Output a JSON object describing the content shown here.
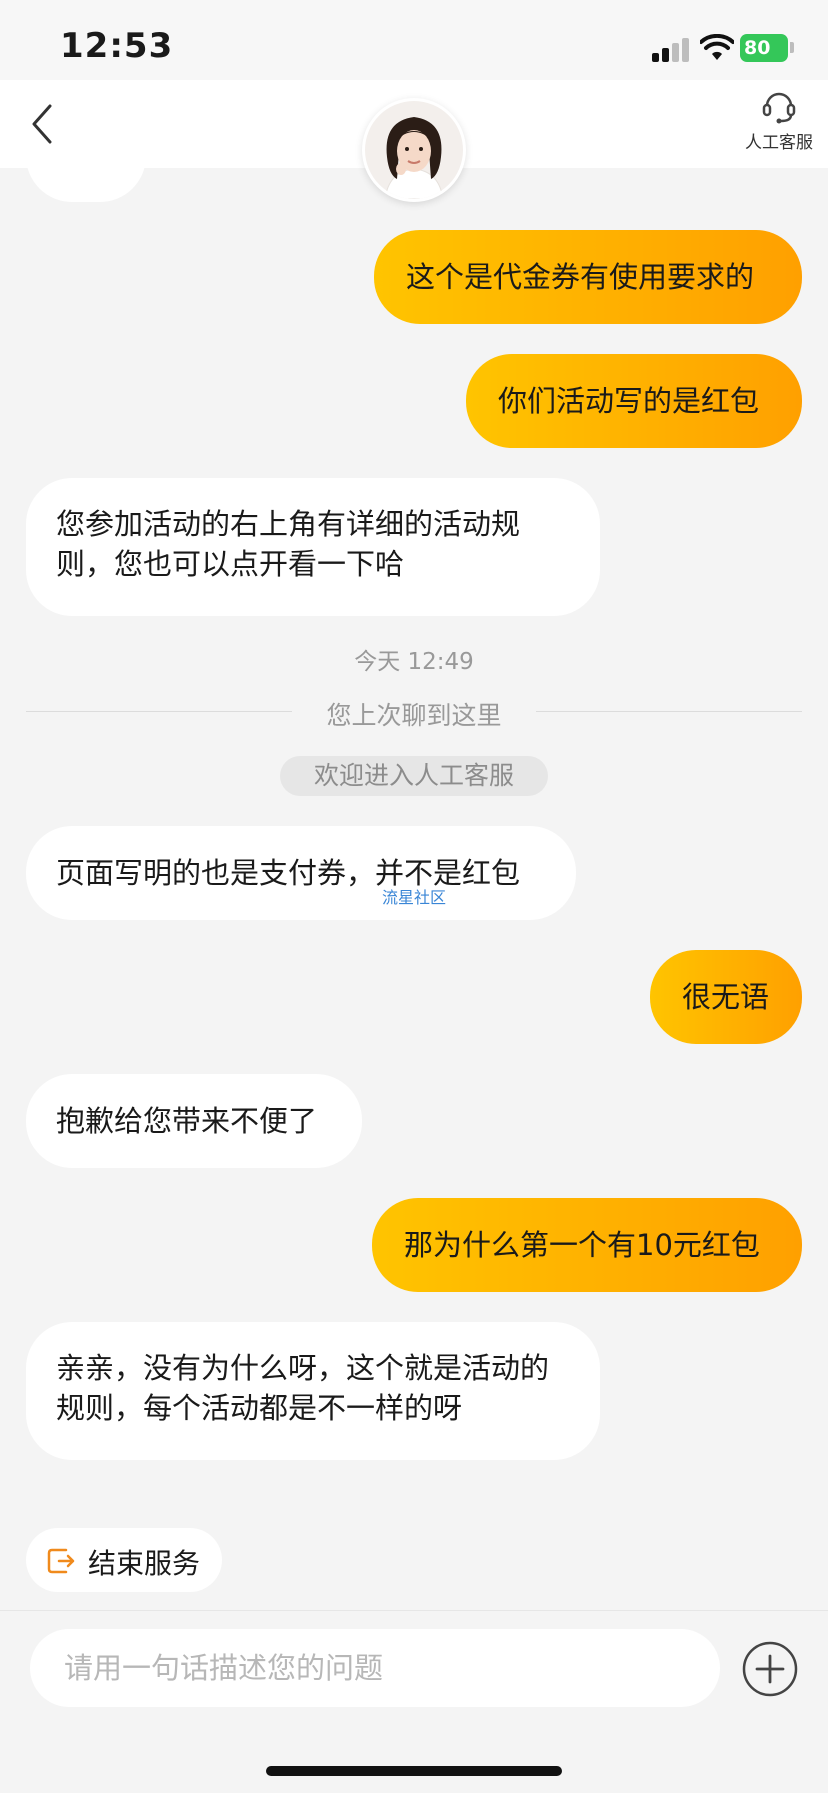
{
  "status_bar": {
    "time": "12:53",
    "battery": "80"
  },
  "header": {
    "agent_label": "人工客服"
  },
  "messages": [
    {
      "side": "right",
      "text": "这个是代金券有使用要求的"
    },
    {
      "side": "right",
      "text": "你们活动写的是红包"
    },
    {
      "side": "left",
      "text": "您参加活动的右上角有详细的活动规则，您也可以点开看一下哈"
    },
    {
      "side": "left",
      "text": "页面写明的也是支付券，并不是红包"
    },
    {
      "side": "right",
      "text": "很无语"
    },
    {
      "side": "left",
      "text": "抱歉给您带来不便了"
    },
    {
      "side": "right",
      "text": "那为什么第一个有10元红包"
    },
    {
      "side": "left",
      "text": "亲亲，没有为什么呀，这个就是活动的规则，每个活动都是不一样的呀"
    }
  ],
  "timestamp": "今天 12:49",
  "divider": "您上次聊到这里",
  "system_notice": "欢迎进入人工客服",
  "watermark": "流星社区",
  "end_service": {
    "label": "结束服务"
  },
  "input": {
    "placeholder": "请用一句话描述您的问题"
  },
  "colors": {
    "bubble_right_start": "#ffc400",
    "bubble_right_end": "#ffa000",
    "end_icon": "#f08a1c"
  }
}
